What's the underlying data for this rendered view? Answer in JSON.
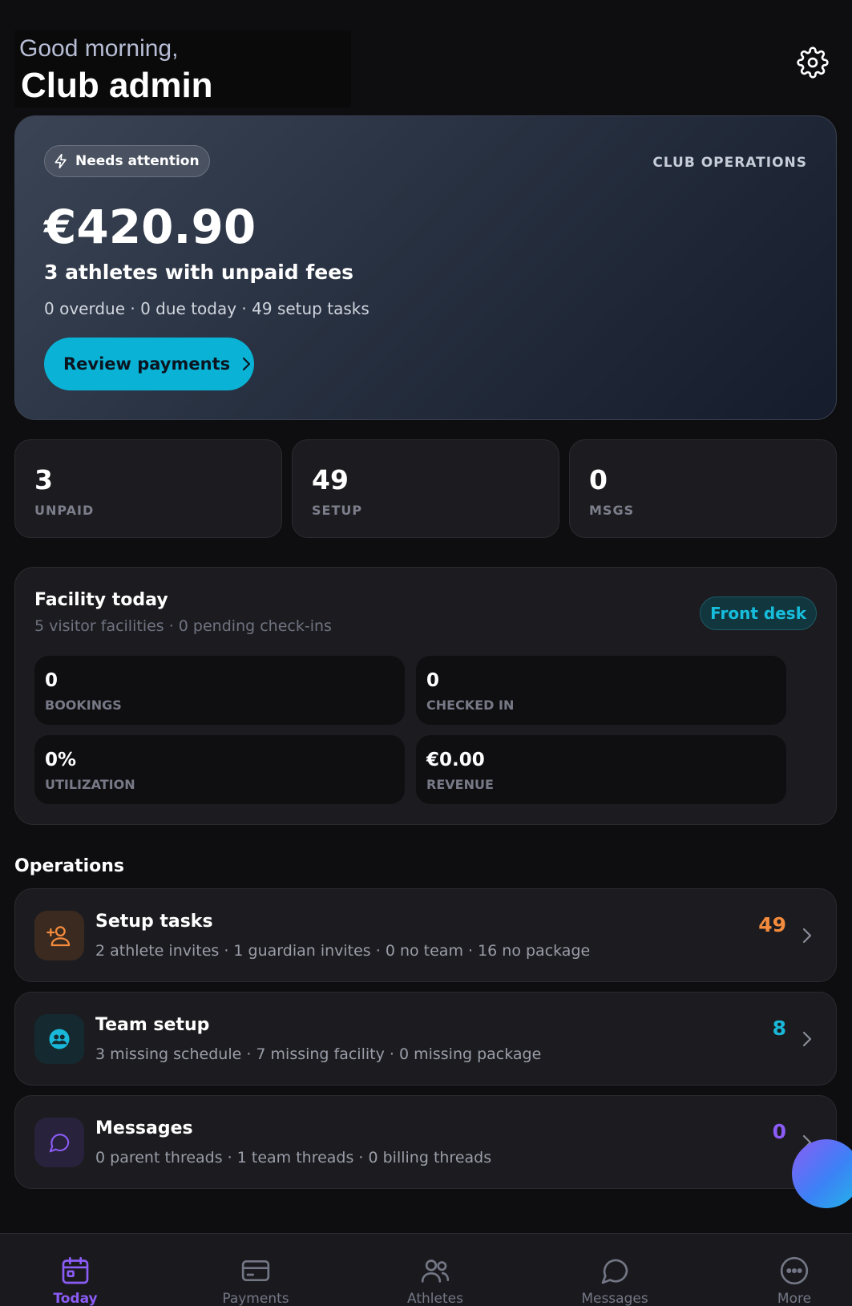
{
  "header": {
    "greeting": "Good morning,",
    "name": "Club admin",
    "settings_icon": "gear-icon"
  },
  "hero": {
    "badge": "Needs attention",
    "badge_icon": "lightning-icon",
    "tag": "CLUB OPERATIONS",
    "amount": "€420.90",
    "title": "3 athletes with unpaid fees",
    "subtitle": "0 overdue · 0 due today · 49 setup tasks",
    "cta": "Review payments",
    "cta_color": "#0ab3d6"
  },
  "stats": [
    {
      "value": "3",
      "label": "UNPAID"
    },
    {
      "value": "49",
      "label": "SETUP"
    },
    {
      "value": "0",
      "label": "MSGS"
    }
  ],
  "facility": {
    "title": "Facility today",
    "subtitle": "5 visitor facilities · 0 pending check-ins",
    "front_desk": "Front desk",
    "tiles": [
      {
        "value": "0",
        "label": "BOOKINGS"
      },
      {
        "value": "0",
        "label": "CHECKED IN"
      },
      {
        "value": "0%",
        "label": "UTILIZATION"
      },
      {
        "value": "€0.00",
        "label": "REVENUE"
      }
    ]
  },
  "operations": {
    "title": "Operations",
    "items": [
      {
        "title": "Setup tasks",
        "subtitle": "2 athlete invites · 1 guardian invites · 0 no team · 16 no package",
        "count": "49",
        "color": "#f58b3c",
        "icon": "user-plus-icon"
      },
      {
        "title": "Team setup",
        "subtitle": "3 missing schedule · 7 missing facility · 0 missing package",
        "count": "8",
        "color": "#19b8d8",
        "icon": "team-icon"
      },
      {
        "title": "Messages",
        "subtitle": "0 parent threads · 1 team threads · 0 billing threads",
        "count": "0",
        "color": "#8b5cf6",
        "icon": "chat-icon"
      }
    ]
  },
  "tabbar": {
    "active_color": "#8b5cf6",
    "tabs": [
      {
        "label": "Today",
        "icon": "calendar-icon"
      },
      {
        "label": "Payments",
        "icon": "card-icon"
      },
      {
        "label": "Athletes",
        "icon": "people-icon"
      },
      {
        "label": "Messages",
        "icon": "chat-icon"
      },
      {
        "label": "More",
        "icon": "more-icon"
      }
    ]
  }
}
